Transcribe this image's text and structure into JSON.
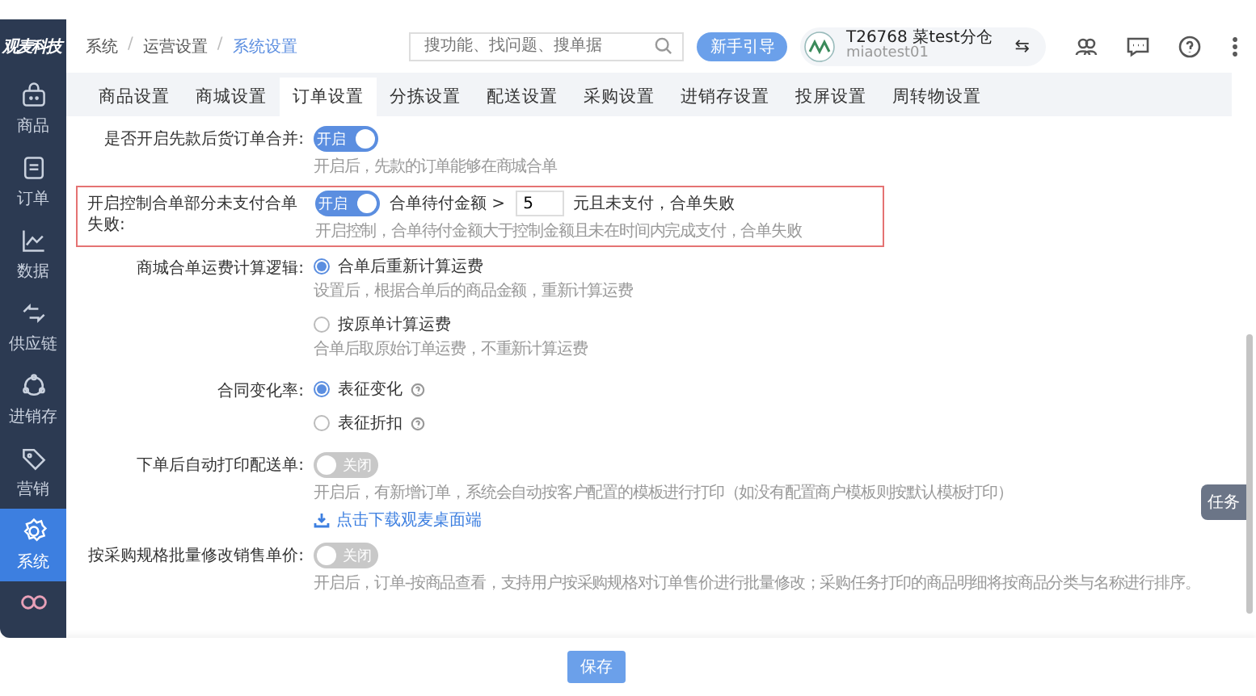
{
  "sidebar": {
    "logo": "观麦科技",
    "items": [
      {
        "label": "商品",
        "selected": false
      },
      {
        "label": "订单",
        "selected": false
      },
      {
        "label": "数据",
        "selected": false
      },
      {
        "label": "供应链",
        "selected": false
      },
      {
        "label": "进销存",
        "selected": false
      },
      {
        "label": "营销",
        "selected": false
      },
      {
        "label": "系统",
        "selected": true
      }
    ]
  },
  "breadcrumb": [
    {
      "kind": "link",
      "label": "系统",
      "current": false
    },
    {
      "kind": "separator",
      "label": "/"
    },
    {
      "kind": "link",
      "label": "运营设置",
      "current": false
    },
    {
      "kind": "separator",
      "label": "/"
    },
    {
      "kind": "link",
      "label": "系统设置",
      "current": true
    }
  ],
  "search": {
    "placeholder": "搜功能、找问题、搜单据"
  },
  "guide_button": "新手引导",
  "account": {
    "name": "T26768 菜test分仓",
    "user": "miaotest01",
    "switch": "⇆"
  },
  "tabs": [
    {
      "label": "商品设置",
      "selected": false
    },
    {
      "label": "商城设置",
      "selected": false
    },
    {
      "label": "订单设置",
      "selected": true
    },
    {
      "label": "分拣设置",
      "selected": false
    },
    {
      "label": "配送设置",
      "selected": false
    },
    {
      "label": "采购设置",
      "selected": false
    },
    {
      "label": "进销存设置",
      "selected": false
    },
    {
      "label": "投屏设置",
      "selected": false
    },
    {
      "label": "周转物设置",
      "selected": false
    }
  ],
  "settings": [
    {
      "kind": "switch",
      "label": "是否开启先款后货订单合并:",
      "highlighted": false,
      "on": true,
      "switch_text": "开启",
      "description": "开启后，先款的订单能够在商城合单"
    },
    {
      "kind": "switch",
      "label": "开启控制合单部分未支付合单失败:",
      "highlighted": true,
      "on": true,
      "switch_text": "开启",
      "threshold": {
        "prefix": "合单待付金额 >",
        "value": "5",
        "suffix": "元且未支付，合单失败"
      },
      "description": "开启控制，合单待付金额大于控制金额且未在时间内完成支付，合单失败"
    },
    {
      "kind": "radio",
      "label": "商城合单运费计算逻辑:",
      "highlighted": false,
      "options": [
        {
          "label": "合单后重新计算运费",
          "selected": true,
          "description": "设置后，根据合单后的商品金额，重新计算运费"
        },
        {
          "label": "按原单计算运费",
          "selected": false,
          "description": "合单后取原始订单运费，不重新计算运费"
        }
      ]
    },
    {
      "kind": "radio",
      "label": "合同变化率:",
      "highlighted": false,
      "options": [
        {
          "label": "表征变化",
          "selected": true,
          "help": true
        },
        {
          "label": "表征折扣",
          "selected": false,
          "help": true
        }
      ]
    },
    {
      "kind": "switch",
      "label": "下单后自动打印配送单:",
      "highlighted": false,
      "on": false,
      "switch_text": "关闭",
      "description": "开启后，有新增订单，系统会自动按客户配置的模板进行打印（如没有配置商户模板则按默认模板打印）",
      "link": "点击下载观麦桌面端"
    },
    {
      "kind": "switch",
      "label": "按采购规格批量修改销售单价:",
      "highlighted": false,
      "on": false,
      "switch_text": "关闭",
      "description": "开启后，订单-按商品查看，支持用户按采购规格对订单售价进行批量修改；采购任务打印的商品明细将按商品分类与名称进行排序。"
    }
  ],
  "save_button": "保存",
  "task_tab": "任务"
}
